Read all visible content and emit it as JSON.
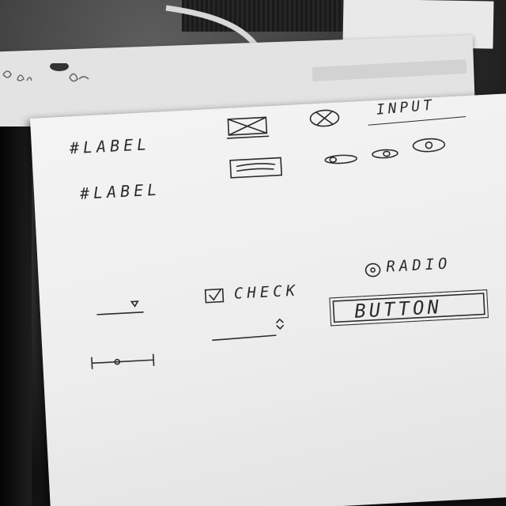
{
  "sketch": {
    "label_1": "#LABEL",
    "label_2": "#LABEL",
    "input_label": "INPUT",
    "checkbox_label": "CHECK",
    "radio_label": "RADIO",
    "button_label": "BUTTON"
  },
  "colors": {
    "ink": "#2b2b2b",
    "paper": "#f0f0f0",
    "background": "#121212"
  }
}
